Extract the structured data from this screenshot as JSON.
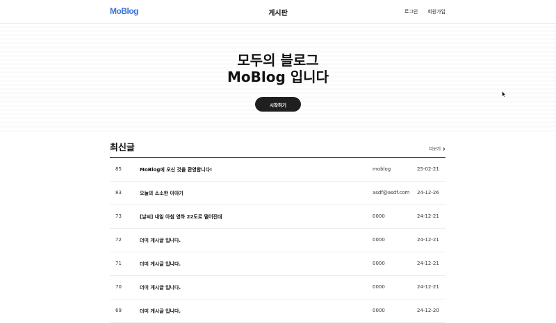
{
  "header": {
    "logo": "MoBlog",
    "title": "게시판",
    "login": "로그인",
    "signup": "회원가입"
  },
  "hero": {
    "line1": "모두의 블로그",
    "line2": "MoBlog 입니다",
    "start_button": "시작하기"
  },
  "recent": {
    "title": "최신글",
    "more": "더보기",
    "posts": [
      {
        "id": "85",
        "title": "MoBlog에 오신 것을 환영합니다!",
        "author": "moblog",
        "date": "25-02-21"
      },
      {
        "id": "83",
        "title": "오늘의 소소한 이야기",
        "author": "asdf@asdf.com",
        "date": "24-12-26"
      },
      {
        "id": "73",
        "title": "[날씨] 내일 아침 영하 22도로 떨어진대",
        "author": "0000",
        "date": "24-12-21"
      },
      {
        "id": "72",
        "title": "더미 게시글 입니다.",
        "author": "0000",
        "date": "24-12-21"
      },
      {
        "id": "71",
        "title": "더미 게시글 입니다.",
        "author": "0000",
        "date": "24-12-21"
      },
      {
        "id": "70",
        "title": "더미 게시글 입니다.",
        "author": "0000",
        "date": "24-12-21"
      },
      {
        "id": "69",
        "title": "더미 게시글 입니다.",
        "author": "0000",
        "date": "24-12-20"
      }
    ]
  },
  "icons": {
    "chevron": "chevron-right-icon",
    "cursor": "mouse-cursor-icon"
  },
  "colors": {
    "brand": "#3b73d6",
    "button_bg": "#1f1f1f"
  }
}
